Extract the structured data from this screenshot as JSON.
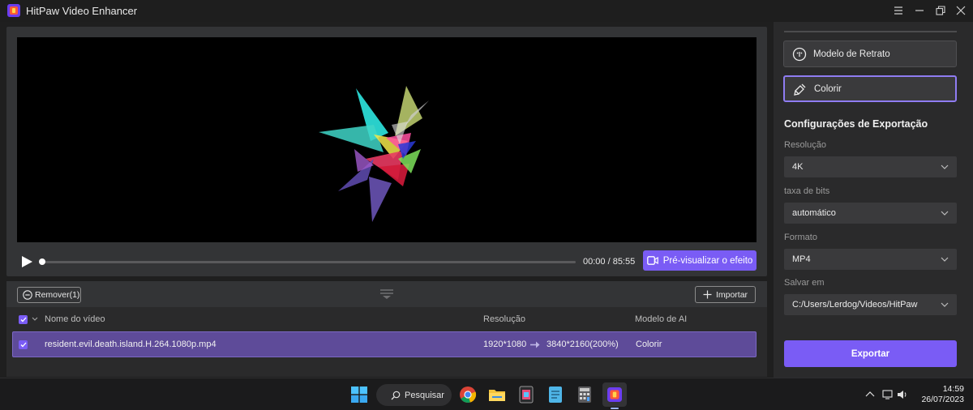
{
  "window": {
    "title": "HitPaw Video Enhancer",
    "controls": [
      "menu-icon",
      "minimize-icon",
      "restore-icon",
      "close-icon"
    ]
  },
  "player": {
    "time": "00:00 / 85:55",
    "progress": 0,
    "preview_label": "Pré-visualizar o efeito"
  },
  "list": {
    "remove_label": "Remover(1)",
    "import_label": "Importar",
    "headers": {
      "name": "Nome do vídeo",
      "resolution": "Resolução",
      "model": "Modelo de AI"
    },
    "rows": [
      {
        "name": "resident.evil.death.island.H.264.1080p.mp4",
        "resolution_from": "1920*1080",
        "resolution_to": "3840*2160(200%)",
        "model": "Colorir",
        "checked": true
      }
    ]
  },
  "sidebar": {
    "models": [
      {
        "label": "Modelo de Retrato",
        "icon": "portrait-icon",
        "selected": false
      },
      {
        "label": "Colorir",
        "icon": "brush-icon",
        "selected": true
      }
    ],
    "export_heading": "Configurações de Exportação",
    "resolution_label": "Resolução",
    "resolution_value": "4K",
    "bitrate_label": "taxa de bits",
    "bitrate_value": "automático",
    "format_label": "Formato",
    "format_value": "MP4",
    "save_label": "Salvar em",
    "save_value": "C:/Users/Lerdog/Videos/HitPaw",
    "export_button": "Exportar"
  },
  "taskbar": {
    "search_label": "Pesquisar",
    "time": "14:59",
    "date": "26/07/2023"
  },
  "colors": {
    "accent": "#7a5cf5",
    "row_selected": "#5e4b99"
  }
}
